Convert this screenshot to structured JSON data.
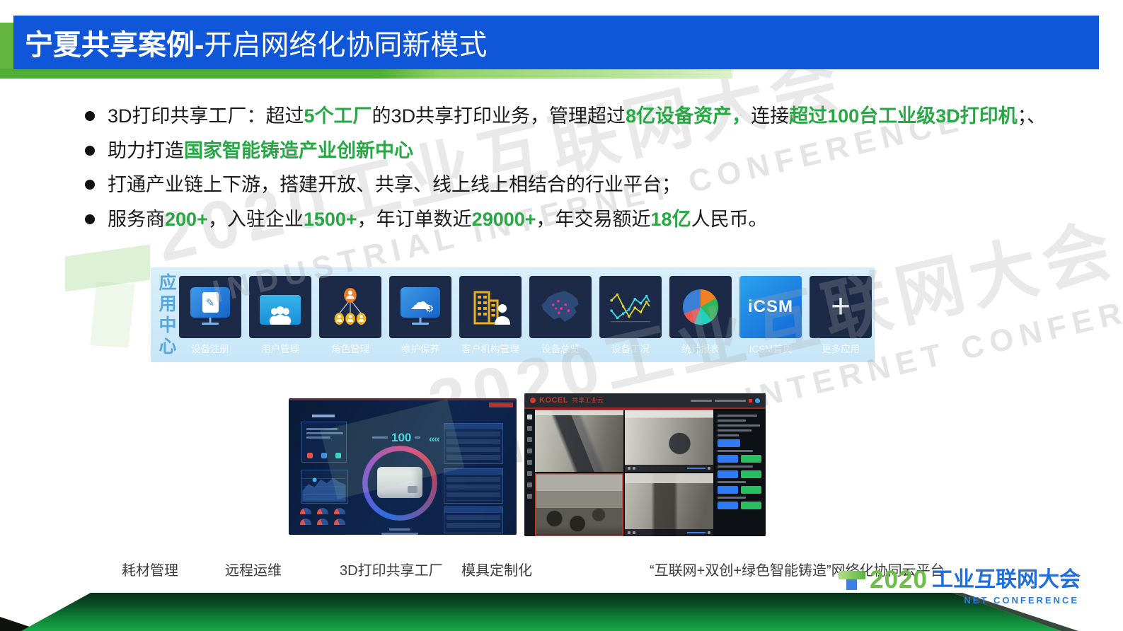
{
  "title": {
    "emphasis": "宁夏共享案例-",
    "rest": "开启网络化协同新模式"
  },
  "bullets": [
    {
      "segments": [
        "3D打印共享工厂：超过",
        "5个工厂",
        "的3D共享打印业务，管理超过",
        "8亿设备资产，",
        "连接",
        "超过100台工业级3D打印机",
        "；、"
      ]
    },
    {
      "segments": [
        "助力打造",
        "国家智能铸造产业创新中心"
      ]
    },
    {
      "segments": [
        "打通产业链上下游，搭建开放、共享、线上线上相结合的行业平台；"
      ]
    },
    {
      "segments": [
        "服务商",
        "200+",
        "，入驻企业",
        "1500+",
        "，年订单数近",
        "29000+",
        "，年交易额近",
        "18亿",
        "人民币。"
      ]
    }
  ],
  "watermark": {
    "line1": "2020工业互联网大会",
    "line2": "INDUSTRIAL INTERNET CONFERENCE"
  },
  "app_center": {
    "label": "应用中心",
    "apps": [
      {
        "label": "设备注册"
      },
      {
        "label": "用户管理"
      },
      {
        "label": "角色管理"
      },
      {
        "label": "维护保养"
      },
      {
        "label": "客户机构管理"
      },
      {
        "label": "设备总览"
      },
      {
        "label": "设备工况"
      },
      {
        "label": "统计报表"
      },
      {
        "label": "ICSM首页"
      },
      {
        "label": "更多应用"
      }
    ],
    "icsm_text": "iCSM",
    "plus_glyph": "+"
  },
  "dashboard": {
    "metric": "100",
    "chevrons": "‹‹‹‹"
  },
  "kocel": {
    "brand": "KOCEL",
    "product": "共享工业云"
  },
  "captions": [
    "耗材管理",
    "远程运维",
    "3D打印共享工厂",
    "模具定制化",
    "“互联网+双创+绿色智能铸造”网络化协同云平台"
  ],
  "footer_logo": {
    "year": "2020",
    "title": "工业互联网大会",
    "subtitle": "NET CONFERENCE"
  },
  "colors": {
    "title_bar": "#0F56D9",
    "accent_green": "#63B53F",
    "highlight_green": "#27A844"
  }
}
